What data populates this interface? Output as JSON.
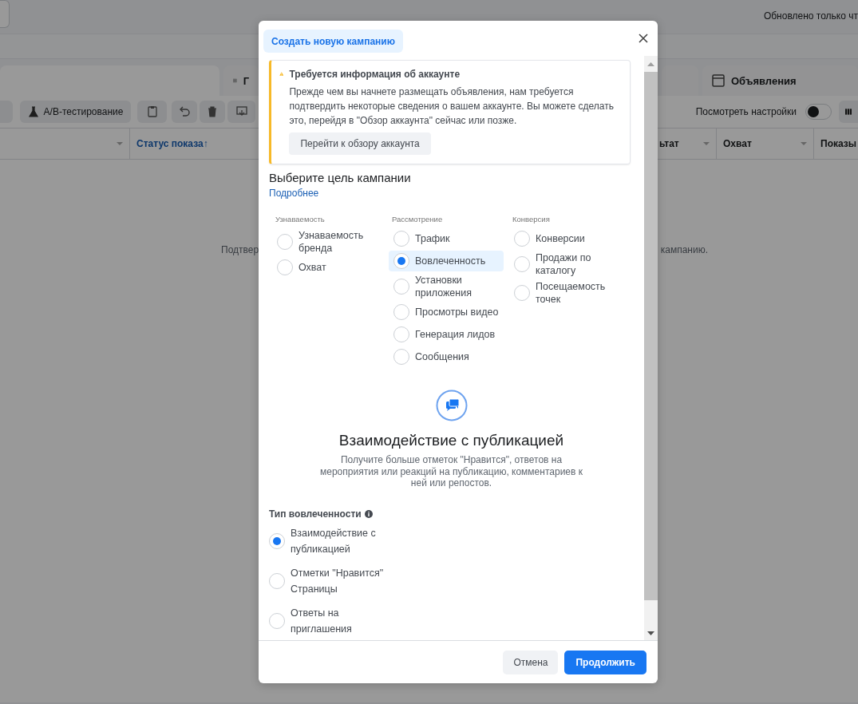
{
  "background": {
    "status_text": "Обновлено только чт",
    "tabs": [
      {
        "label": "Г"
      },
      {
        "label": "Объявления"
      }
    ],
    "toolbar": {
      "ab_test": "A/B-тестирование",
      "view_settings": "Посмотреть настройки",
      "view_settings_on": false
    },
    "table": {
      "columns": [
        "Статус показа↑",
        "ьтат",
        "Охват",
        "Показы"
      ]
    },
    "message_start": "Подтвер",
    "message_end": "кампанию."
  },
  "dialog": {
    "title": "Создать новую кампанию",
    "alert": {
      "title": "Требуется информация об аккаунте",
      "text": "Прежде чем вы начнете размещать объявления, нам требуется подтвердить некоторые сведения о вашем аккаунте. Вы можете сделать это, перейдя в \"Обзор аккаунта\" сейчас или позже.",
      "button": "Перейти к обзору аккаунта"
    },
    "objective": {
      "heading": "Выберите цель кампании",
      "link": "Подробнее",
      "groups": [
        {
          "label": "Узнаваемость",
          "options": [
            {
              "label": "Узнаваемость бренда",
              "selected": false
            },
            {
              "label": "Охват",
              "selected": false
            }
          ]
        },
        {
          "label": "Рассмотрение",
          "options": [
            {
              "label": "Трафик",
              "selected": false
            },
            {
              "label": "Вовлеченность",
              "selected": true
            },
            {
              "label": "Установки приложения",
              "selected": false
            },
            {
              "label": "Просмотры видео",
              "selected": false
            },
            {
              "label": "Генерация лидов",
              "selected": false
            },
            {
              "label": "Сообщения",
              "selected": false
            }
          ]
        },
        {
          "label": "Конверсия",
          "options": [
            {
              "label": "Конверсии",
              "selected": false
            },
            {
              "label": "Продажи по каталогу",
              "selected": false
            },
            {
              "label": "Посещаемость точек",
              "selected": false
            }
          ]
        }
      ]
    },
    "detail": {
      "title": "Взаимодействие с публикацией",
      "description": "Получите больше отметок \"Нравится\", ответов на мероприятия или реакций на публикацию, комментариев к ней или репостов."
    },
    "engagement_type": {
      "label": "Тип вовлеченности",
      "options": [
        {
          "label": "Взаимодействие с публикацией",
          "selected": true
        },
        {
          "label": "Отметки \"Нравится\" Страницы",
          "selected": false
        },
        {
          "label": "Ответы на приглашения",
          "selected": false
        }
      ]
    },
    "buttons": {
      "cancel": "Отмена",
      "continue": "Продолжить"
    }
  }
}
